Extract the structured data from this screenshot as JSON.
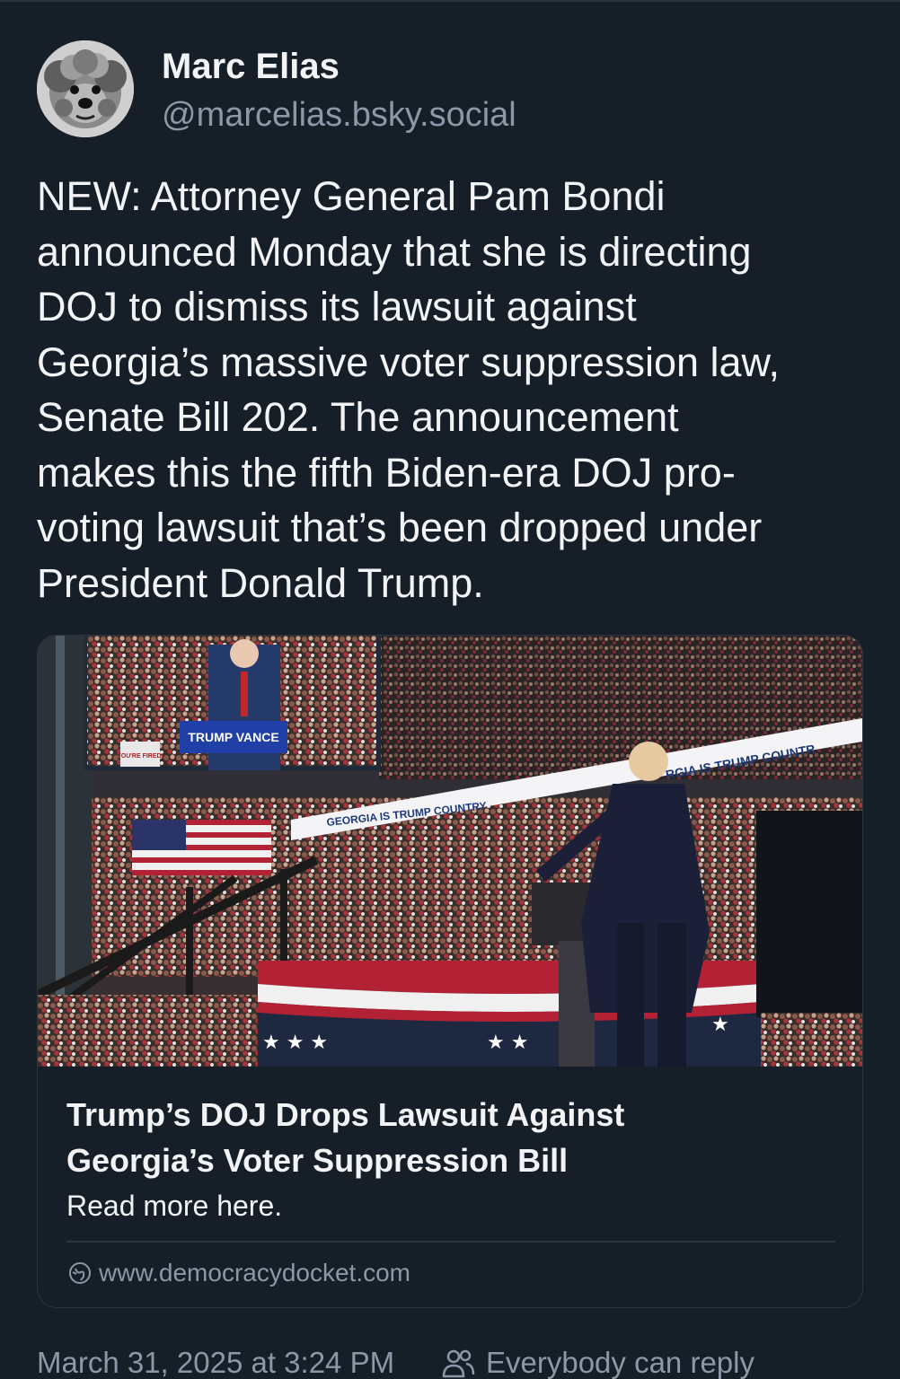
{
  "author": {
    "display_name": "Marc Elias",
    "handle": "@marcelias.bsky.social",
    "avatar_icon": "dog-avatar"
  },
  "post": {
    "text_lines": [
      "NEW: Attorney General Pam Bondi",
      "announced Monday that she is directing",
      "DOJ to dismiss its lawsuit against",
      "Georgia’s massive voter suppression law,",
      "Senate Bill 202. The announcement",
      "makes this the fifth Biden-era DOJ pro-",
      "voting lawsuit that’s been dropped under",
      "President Donald Trump."
    ]
  },
  "link_card": {
    "image": {
      "screen_sign": "TRUMP VANCE",
      "banner_text": "GEORGIA IS TRUMP COUNTRY",
      "banner_text_right": "RGIA IS TRUMP COUNTR",
      "sign_text": "YOU'RE FIRED!"
    },
    "title_lines": [
      "Trump’s DOJ Drops Lawsuit Against",
      "Georgia’s Voter Suppression Bill"
    ],
    "description": "Read more here.",
    "domain": "www.democracydocket.com",
    "domain_icon": "globe-icon"
  },
  "footer": {
    "timestamp": "March 31, 2025 at 3:24 PM",
    "reply_setting": "Everybody can reply",
    "reply_icon": "people-icon"
  },
  "colors": {
    "background": "#161e27",
    "text": "#f1f3f5",
    "secondary_text": "#8b98a8",
    "border": "#2c3643"
  }
}
